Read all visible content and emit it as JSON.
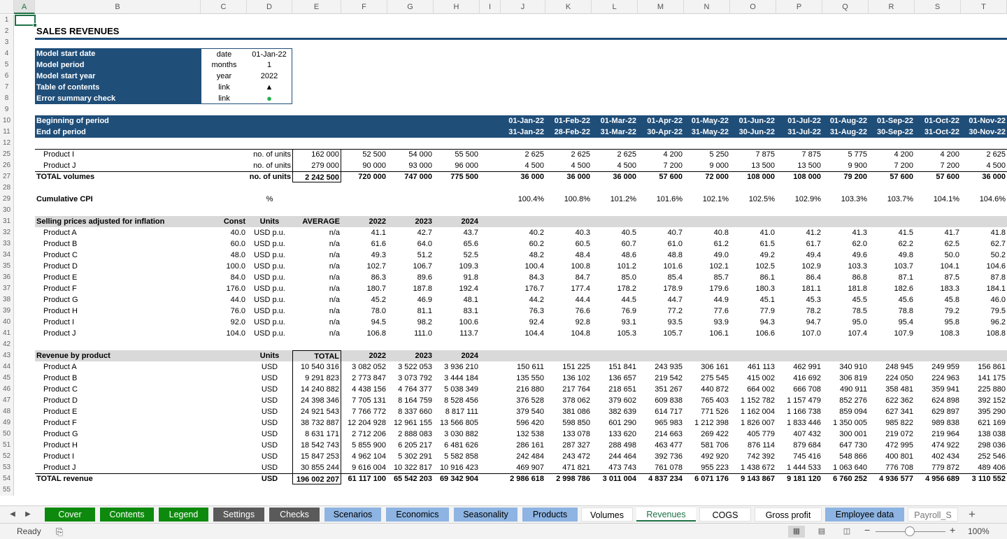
{
  "columns": [
    "A",
    "B",
    "C",
    "D",
    "E",
    "F",
    "G",
    "H",
    "I",
    "J",
    "K",
    "L",
    "M",
    "N",
    "O",
    "P",
    "Q",
    "R",
    "S",
    "T"
  ],
  "selected_column": "A",
  "title": "SALES REVENUES",
  "settings": {
    "rows": [
      {
        "rn": "4",
        "label": "Model start date",
        "unit": "date",
        "value": "01-Jan-22"
      },
      {
        "rn": "5",
        "label": "Model period",
        "unit": "months",
        "value": "1"
      },
      {
        "rn": "6",
        "label": "Model start year",
        "unit": "year",
        "value": "2022"
      },
      {
        "rn": "7",
        "label": "Table of contents",
        "unit": "link",
        "value": "▲"
      },
      {
        "rn": "8",
        "label": "Error summary check",
        "unit": "link",
        "value": "●"
      }
    ],
    "status_color": "#22b14c"
  },
  "periods": {
    "begin_label": "Beginning of period",
    "end_label": "End of period",
    "begin": [
      "01-Jan-22",
      "01-Feb-22",
      "01-Mar-22",
      "01-Apr-22",
      "01-May-22",
      "01-Jun-22",
      "01-Jul-22",
      "01-Aug-22",
      "01-Sep-22",
      "01-Oct-22",
      "01-Nov-22"
    ],
    "end": [
      "31-Jan-22",
      "28-Feb-22",
      "31-Mar-22",
      "30-Apr-22",
      "31-May-22",
      "30-Jun-22",
      "31-Jul-22",
      "31-Aug-22",
      "30-Sep-22",
      "31-Oct-22",
      "30-Nov-22"
    ]
  },
  "volumes": {
    "rows": [
      {
        "rn": "25",
        "label": "Product I",
        "unit": "no. of units",
        "total": "162 000",
        "y": [
          "52 500",
          "54 000",
          "55 500"
        ],
        "m": [
          "2 625",
          "2 625",
          "2 625",
          "4 200",
          "5 250",
          "7 875",
          "7 875",
          "5 775",
          "4 200",
          "4 200",
          "2 625"
        ]
      },
      {
        "rn": "26",
        "label": "Product J",
        "unit": "no. of units",
        "total": "279 000",
        "y": [
          "90 000",
          "93 000",
          "96 000"
        ],
        "m": [
          "4 500",
          "4 500",
          "4 500",
          "7 200",
          "9 000",
          "13 500",
          "13 500",
          "9 900",
          "7 200",
          "7 200",
          "4 500"
        ]
      }
    ],
    "total": {
      "rn": "27",
      "label": "TOTAL volumes",
      "unit": "no. of units",
      "total": "2 242 500",
      "y": [
        "720 000",
        "747 000",
        "775 500"
      ],
      "m": [
        "36 000",
        "36 000",
        "36 000",
        "57 600",
        "72 000",
        "108 000",
        "108 000",
        "79 200",
        "57 600",
        "57 600",
        "36 000"
      ]
    }
  },
  "cpi": {
    "rn": "29",
    "label": "Cumulative CPI",
    "unit": "%",
    "m": [
      "100.4%",
      "100.8%",
      "101.2%",
      "101.6%",
      "102.1%",
      "102.5%",
      "102.9%",
      "103.3%",
      "103.7%",
      "104.1%",
      "104.6%"
    ]
  },
  "prices": {
    "header": {
      "rn": "31",
      "label": "Selling prices adjusted for inflation",
      "const": "Const",
      "units": "Units",
      "avg": "AVERAGE",
      "y": [
        "2022",
        "2023",
        "2024"
      ]
    },
    "rows": [
      {
        "rn": "32",
        "label": "Product A",
        "const": "40.0",
        "unit": "USD p.u.",
        "avg": "n/a",
        "y": [
          "41.1",
          "42.7",
          "43.7"
        ],
        "m": [
          "40.2",
          "40.3",
          "40.5",
          "40.7",
          "40.8",
          "41.0",
          "41.2",
          "41.3",
          "41.5",
          "41.7",
          "41.8"
        ]
      },
      {
        "rn": "33",
        "label": "Product B",
        "const": "60.0",
        "unit": "USD p.u.",
        "avg": "n/a",
        "y": [
          "61.6",
          "64.0",
          "65.6"
        ],
        "m": [
          "60.2",
          "60.5",
          "60.7",
          "61.0",
          "61.2",
          "61.5",
          "61.7",
          "62.0",
          "62.2",
          "62.5",
          "62.7"
        ]
      },
      {
        "rn": "34",
        "label": "Product C",
        "const": "48.0",
        "unit": "USD p.u.",
        "avg": "n/a",
        "y": [
          "49.3",
          "51.2",
          "52.5"
        ],
        "m": [
          "48.2",
          "48.4",
          "48.6",
          "48.8",
          "49.0",
          "49.2",
          "49.4",
          "49.6",
          "49.8",
          "50.0",
          "50.2"
        ]
      },
      {
        "rn": "35",
        "label": "Product D",
        "const": "100.0",
        "unit": "USD p.u.",
        "avg": "n/a",
        "y": [
          "102.7",
          "106.7",
          "109.3"
        ],
        "m": [
          "100.4",
          "100.8",
          "101.2",
          "101.6",
          "102.1",
          "102.5",
          "102.9",
          "103.3",
          "103.7",
          "104.1",
          "104.6"
        ]
      },
      {
        "rn": "36",
        "label": "Product E",
        "const": "84.0",
        "unit": "USD p.u.",
        "avg": "n/a",
        "y": [
          "86.3",
          "89.6",
          "91.8"
        ],
        "m": [
          "84.3",
          "84.7",
          "85.0",
          "85.4",
          "85.7",
          "86.1",
          "86.4",
          "86.8",
          "87.1",
          "87.5",
          "87.8"
        ]
      },
      {
        "rn": "37",
        "label": "Product F",
        "const": "176.0",
        "unit": "USD p.u.",
        "avg": "n/a",
        "y": [
          "180.7",
          "187.8",
          "192.4"
        ],
        "m": [
          "176.7",
          "177.4",
          "178.2",
          "178.9",
          "179.6",
          "180.3",
          "181.1",
          "181.8",
          "182.6",
          "183.3",
          "184.1"
        ]
      },
      {
        "rn": "38",
        "label": "Product G",
        "const": "44.0",
        "unit": "USD p.u.",
        "avg": "n/a",
        "y": [
          "45.2",
          "46.9",
          "48.1"
        ],
        "m": [
          "44.2",
          "44.4",
          "44.5",
          "44.7",
          "44.9",
          "45.1",
          "45.3",
          "45.5",
          "45.6",
          "45.8",
          "46.0"
        ]
      },
      {
        "rn": "39",
        "label": "Product H",
        "const": "76.0",
        "unit": "USD p.u.",
        "avg": "n/a",
        "y": [
          "78.0",
          "81.1",
          "83.1"
        ],
        "m": [
          "76.3",
          "76.6",
          "76.9",
          "77.2",
          "77.6",
          "77.9",
          "78.2",
          "78.5",
          "78.8",
          "79.2",
          "79.5"
        ]
      },
      {
        "rn": "40",
        "label": "Product I",
        "const": "92.0",
        "unit": "USD p.u.",
        "avg": "n/a",
        "y": [
          "94.5",
          "98.2",
          "100.6"
        ],
        "m": [
          "92.4",
          "92.8",
          "93.1",
          "93.5",
          "93.9",
          "94.3",
          "94.7",
          "95.0",
          "95.4",
          "95.8",
          "96.2"
        ]
      },
      {
        "rn": "41",
        "label": "Product J",
        "const": "104.0",
        "unit": "USD p.u.",
        "avg": "n/a",
        "y": [
          "106.8",
          "111.0",
          "113.7"
        ],
        "m": [
          "104.4",
          "104.8",
          "105.3",
          "105.7",
          "106.1",
          "106.6",
          "107.0",
          "107.4",
          "107.9",
          "108.3",
          "108.8"
        ]
      }
    ]
  },
  "revenue": {
    "header": {
      "rn": "43",
      "label": "Revenue by product",
      "units": "Units",
      "total": "TOTAL",
      "y": [
        "2022",
        "2023",
        "2024"
      ]
    },
    "rows": [
      {
        "rn": "44",
        "label": "Product A",
        "unit": "USD",
        "total": "10 540 316",
        "y": [
          "3 082 052",
          "3 522 053",
          "3 936 210"
        ],
        "m": [
          "150 611",
          "151 225",
          "151 841",
          "243 935",
          "306 161",
          "461 113",
          "462 991",
          "340 910",
          "248 945",
          "249 959",
          "156 861"
        ]
      },
      {
        "rn": "45",
        "label": "Product B",
        "unit": "USD",
        "total": "9 291 823",
        "y": [
          "2 773 847",
          "3 073 792",
          "3 444 184"
        ],
        "m": [
          "135 550",
          "136 102",
          "136 657",
          "219 542",
          "275 545",
          "415 002",
          "416 692",
          "306 819",
          "224 050",
          "224 963",
          "141 175"
        ]
      },
      {
        "rn": "46",
        "label": "Product C",
        "unit": "USD",
        "total": "14 240 882",
        "y": [
          "4 438 156",
          "4 764 377",
          "5 038 349"
        ],
        "m": [
          "216 880",
          "217 764",
          "218 651",
          "351 267",
          "440 872",
          "664 002",
          "666 708",
          "490 911",
          "358 481",
          "359 941",
          "225 880"
        ]
      },
      {
        "rn": "47",
        "label": "Product D",
        "unit": "USD",
        "total": "24 398 346",
        "y": [
          "7 705 131",
          "8 164 759",
          "8 528 456"
        ],
        "m": [
          "376 528",
          "378 062",
          "379 602",
          "609 838",
          "765 403",
          "1 152 782",
          "1 157 479",
          "852 276",
          "622 362",
          "624 898",
          "392 152"
        ]
      },
      {
        "rn": "48",
        "label": "Product E",
        "unit": "USD",
        "total": "24 921 543",
        "y": [
          "7 766 772",
          "8 337 660",
          "8 817 111"
        ],
        "m": [
          "379 540",
          "381 086",
          "382 639",
          "614 717",
          "771 526",
          "1 162 004",
          "1 166 738",
          "859 094",
          "627 341",
          "629 897",
          "395 290"
        ]
      },
      {
        "rn": "49",
        "label": "Product F",
        "unit": "USD",
        "total": "38 732 887",
        "y": [
          "12 204 928",
          "12 961 155",
          "13 566 805"
        ],
        "m": [
          "596 420",
          "598 850",
          "601 290",
          "965 983",
          "1 212 398",
          "1 826 007",
          "1 833 446",
          "1 350 005",
          "985 822",
          "989 838",
          "621 169"
        ]
      },
      {
        "rn": "50",
        "label": "Product G",
        "unit": "USD",
        "total": "8 631 171",
        "y": [
          "2 712 206",
          "2 888 083",
          "3 030 882"
        ],
        "m": [
          "132 538",
          "133 078",
          "133 620",
          "214 663",
          "269 422",
          "405 779",
          "407 432",
          "300 001",
          "219 072",
          "219 964",
          "138 038"
        ]
      },
      {
        "rn": "51",
        "label": "Product H",
        "unit": "USD",
        "total": "18 542 743",
        "y": [
          "5 855 900",
          "6 205 217",
          "6 481 626"
        ],
        "m": [
          "286 161",
          "287 327",
          "288 498",
          "463 477",
          "581 706",
          "876 114",
          "879 684",
          "647 730",
          "472 995",
          "474 922",
          "298 036"
        ]
      },
      {
        "rn": "52",
        "label": "Product I",
        "unit": "USD",
        "total": "15 847 253",
        "y": [
          "4 962 104",
          "5 302 291",
          "5 582 858"
        ],
        "m": [
          "242 484",
          "243 472",
          "244 464",
          "392 736",
          "492 920",
          "742 392",
          "745 416",
          "548 866",
          "400 801",
          "402 434",
          "252 546"
        ]
      },
      {
        "rn": "53",
        "label": "Product J",
        "unit": "USD",
        "total": "30 855 244",
        "y": [
          "9 616 004",
          "10 322 817",
          "10 916 423"
        ],
        "m": [
          "469 907",
          "471 821",
          "473 743",
          "761 078",
          "955 223",
          "1 438 672",
          "1 444 533",
          "1 063 640",
          "776 708",
          "779 872",
          "489 406"
        ]
      }
    ],
    "total": {
      "rn": "54",
      "label": "TOTAL revenue",
      "unit": "USD",
      "total": "196 002 207",
      "y": [
        "61 117 100",
        "65 542 203",
        "69 342 904"
      ],
      "m": [
        "2 986 618",
        "2 998 786",
        "3 011 004",
        "4 837 234",
        "6 071 176",
        "9 143 867",
        "9 181 120",
        "6 760 252",
        "4 936 577",
        "4 956 689",
        "3 110 552"
      ]
    }
  },
  "tabs": [
    {
      "label": "Cover",
      "bg": "#0d8a0d",
      "fg": "#ffffff"
    },
    {
      "label": "Contents",
      "bg": "#0d8a0d",
      "fg": "#ffffff"
    },
    {
      "label": "Legend",
      "bg": "#0d8a0d",
      "fg": "#ffffff"
    },
    {
      "label": "Settings",
      "bg": "#5a5a5a",
      "fg": "#ffffff"
    },
    {
      "label": "Checks",
      "bg": "#5a5a5a",
      "fg": "#ffffff"
    },
    {
      "label": "Scenarios",
      "bg": "#8db4e2",
      "fg": "#000000"
    },
    {
      "label": "Economics",
      "bg": "#8db4e2",
      "fg": "#000000"
    },
    {
      "label": "Seasonality",
      "bg": "#8db4e2",
      "fg": "#000000"
    },
    {
      "label": "Products",
      "bg": "#8db4e2",
      "fg": "#000000"
    },
    {
      "label": "Volumes",
      "bg": "#ffffff",
      "fg": "#000000"
    },
    {
      "label": "Revenues",
      "bg": "#ffffff",
      "fg": "#1e7145",
      "active": true
    },
    {
      "label": "COGS",
      "bg": "#ffffff",
      "fg": "#000000"
    },
    {
      "label": "Gross profit",
      "bg": "#ffffff",
      "fg": "#000000"
    },
    {
      "label": "Employee data",
      "bg": "#8db4e2",
      "fg": "#000000"
    },
    {
      "label": "Payroll_S",
      "bg": "#ffffff",
      "fg": "#777777"
    }
  ],
  "status": {
    "ready": "Ready",
    "zoom": "100%"
  },
  "colors": {
    "navy": "#1f4e79",
    "accent": "#1e7145",
    "band_gray": "#d9d9d9"
  }
}
